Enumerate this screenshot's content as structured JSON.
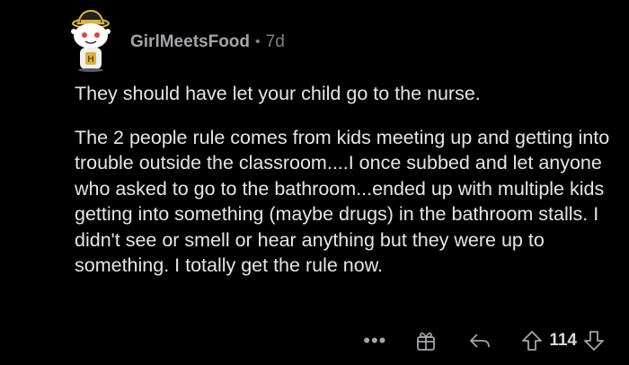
{
  "comment": {
    "author": "GirlMeetsFood",
    "separator": "•",
    "age": "7d",
    "paragraphs": [
      "They should have let your child go to the nurse.",
      "The 2 people rule comes from kids meeting up and getting into trouble outside the classroom....I once subbed and let anyone who asked to go to the bathroom...ended up with multiple kids getting into something (maybe drugs) in the bathroom stalls. I didn't see or smell or hear anything but they were up to something. I totally get the rule now."
    ]
  },
  "actions": {
    "more_label": "•••",
    "score": "114"
  },
  "icons": {
    "avatar": "snoo-avatar-with-hat",
    "award": "award-icon",
    "reply": "reply-icon",
    "upvote": "upvote-icon",
    "downvote": "downvote-icon"
  },
  "colors": {
    "background": "#000000",
    "text": "#e4e6e8",
    "muted": "#818384"
  }
}
